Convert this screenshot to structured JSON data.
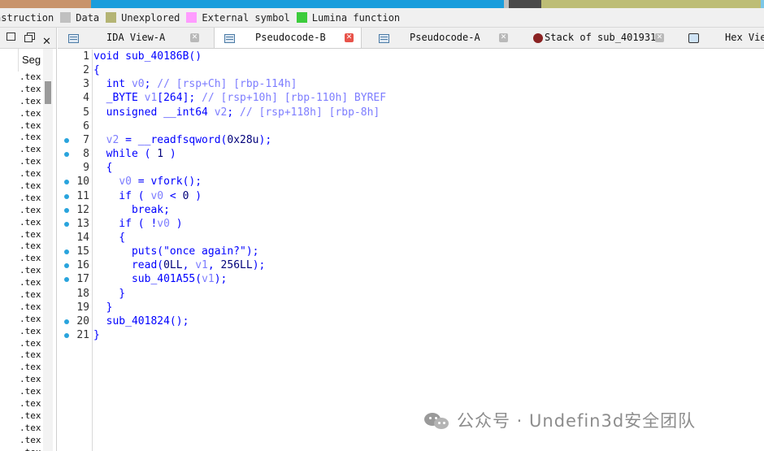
{
  "nav_band_colors": [
    "#c8946c",
    "#1a9ddc",
    "#bfbfbf",
    "#4a4a4a",
    "#bdbd76",
    "#7dc7e8"
  ],
  "legend": {
    "items": [
      {
        "label": "nstruction",
        "color": ""
      },
      {
        "label": "Data",
        "color": "#c0c0c0"
      },
      {
        "label": "Unexplored",
        "color": "#b4b474"
      },
      {
        "label": "External symbol",
        "color": "#ff9cff"
      },
      {
        "label": "Lumina function",
        "color": "#3ccc3c"
      }
    ]
  },
  "left_panel": {
    "header": "Seg",
    "rows": [
      ".tex",
      ".tex",
      ".tex",
      ".tex",
      ".tex",
      ".tex",
      ".tex",
      ".tex",
      ".tex",
      ".tex",
      ".tex",
      ".tex",
      ".tex",
      ".tex",
      ".tex",
      ".tex",
      ".tex",
      ".tex",
      ".tex",
      ".tex",
      ".tex",
      ".tex",
      ".tex",
      ".tex",
      ".tex",
      ".tex",
      ".tex",
      ".tex",
      ".tex",
      ".tex",
      ".tex",
      ".tex",
      ".tex"
    ]
  },
  "tabs": [
    {
      "label": "IDA View-A",
      "active": false,
      "icon": "ida-view-icon",
      "close_color": "#b9b9b9"
    },
    {
      "label": "Pseudocode-B",
      "active": true,
      "icon": "pseudocode-icon",
      "close_color": "#e8534a"
    },
    {
      "label": "Pseudocode-A",
      "active": false,
      "icon": "pseudocode-icon",
      "close_color": "#b9b9b9"
    },
    {
      "label": "Stack of sub_401931",
      "active": false,
      "icon": "stack-icon",
      "close_color": "#b9b9b9"
    },
    {
      "label": "Hex View",
      "active": false,
      "icon": "hex-view-icon",
      "close_color": ""
    }
  ],
  "code": {
    "lines": [
      {
        "n": "1",
        "dot": false,
        "text": "void sub_40186B()"
      },
      {
        "n": "2",
        "dot": false,
        "text": "{"
      },
      {
        "n": "3",
        "dot": false,
        "text": "  int v0; // [rsp+Ch] [rbp-114h]"
      },
      {
        "n": "4",
        "dot": false,
        "text": "  _BYTE v1[264]; // [rsp+10h] [rbp-110h] BYREF"
      },
      {
        "n": "5",
        "dot": false,
        "text": "  unsigned __int64 v2; // [rsp+118h] [rbp-8h]"
      },
      {
        "n": "6",
        "dot": false,
        "text": ""
      },
      {
        "n": "7",
        "dot": true,
        "text": "  v2 = __readfsqword(0x28u);"
      },
      {
        "n": "8",
        "dot": true,
        "text": "  while ( 1 )"
      },
      {
        "n": "9",
        "dot": false,
        "text": "  {"
      },
      {
        "n": "10",
        "dot": true,
        "text": "    v0 = vfork();"
      },
      {
        "n": "11",
        "dot": true,
        "text": "    if ( v0 < 0 )"
      },
      {
        "n": "12",
        "dot": true,
        "text": "      break;"
      },
      {
        "n": "13",
        "dot": true,
        "text": "    if ( !v0 )"
      },
      {
        "n": "14",
        "dot": false,
        "text": "    {"
      },
      {
        "n": "15",
        "dot": true,
        "text": "      puts(\"once again?\");"
      },
      {
        "n": "16",
        "dot": true,
        "text": "      read(0LL, v1, 256LL);"
      },
      {
        "n": "17",
        "dot": true,
        "text": "      sub_401A55(v1);"
      },
      {
        "n": "18",
        "dot": false,
        "text": "    }"
      },
      {
        "n": "19",
        "dot": false,
        "text": "  }"
      },
      {
        "n": "20",
        "dot": true,
        "text": "  sub_401824();"
      },
      {
        "n": "21",
        "dot": true,
        "text": "}"
      }
    ]
  },
  "watermark": {
    "text": "公众号 · Undefin3d安全团队"
  }
}
